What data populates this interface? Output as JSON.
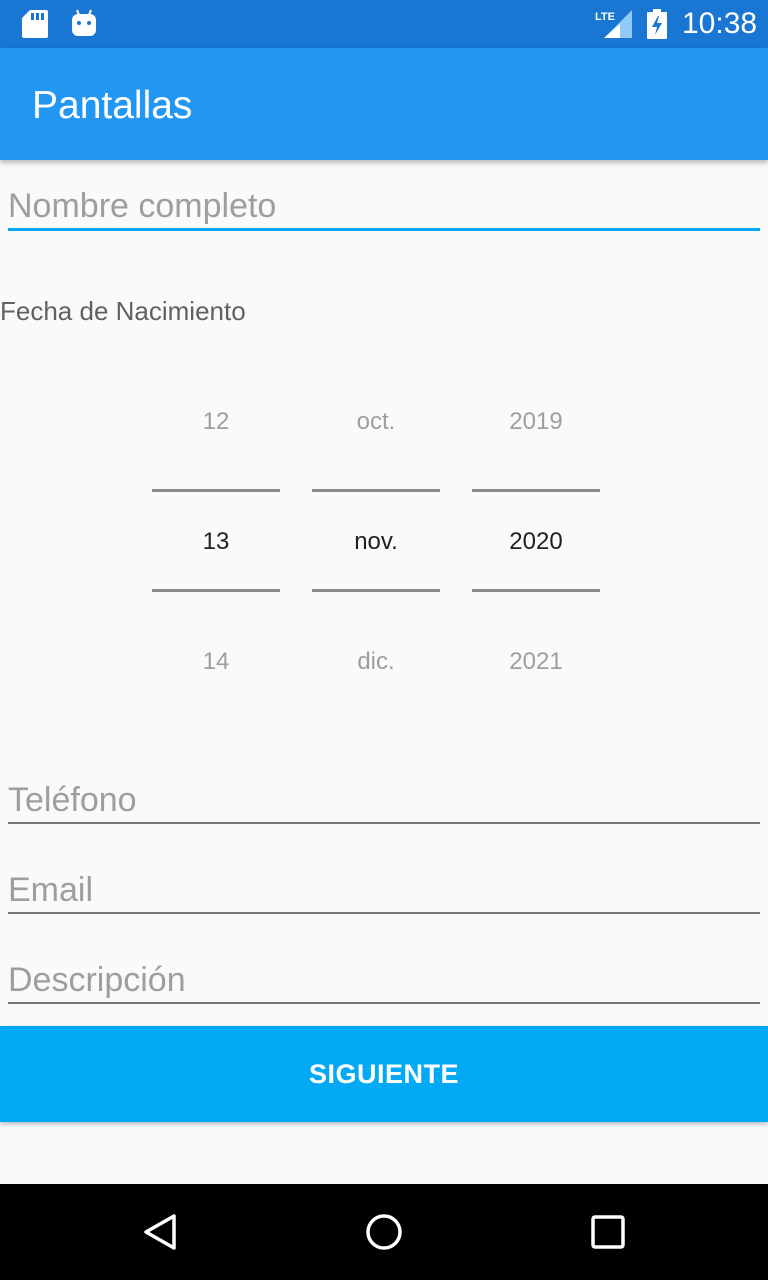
{
  "status_bar": {
    "time": "10:38",
    "network": "LTE",
    "icons": [
      "sd-card-icon",
      "android-icon",
      "lte-signal-icon",
      "battery-charging-icon"
    ]
  },
  "app_bar": {
    "title": "Pantallas"
  },
  "form": {
    "name_placeholder": "Nombre completo",
    "birthdate_label": "Fecha de Nacimiento",
    "date_picker": {
      "day": {
        "prev": "12",
        "current": "13",
        "next": "14"
      },
      "month": {
        "prev": "oct.",
        "current": "nov.",
        "next": "dic."
      },
      "year": {
        "prev": "2019",
        "current": "2020",
        "next": "2021"
      }
    },
    "phone_placeholder": "Teléfono",
    "email_placeholder": "Email",
    "description_placeholder": "Descripción"
  },
  "button": {
    "next_label": "SIGUIENTE"
  },
  "colors": {
    "status_bar": "#1976d2",
    "app_bar": "#2196f3",
    "accent": "#03a9f4"
  },
  "nav_bar": {
    "buttons": [
      "back-icon",
      "home-icon",
      "recents-icon"
    ]
  }
}
